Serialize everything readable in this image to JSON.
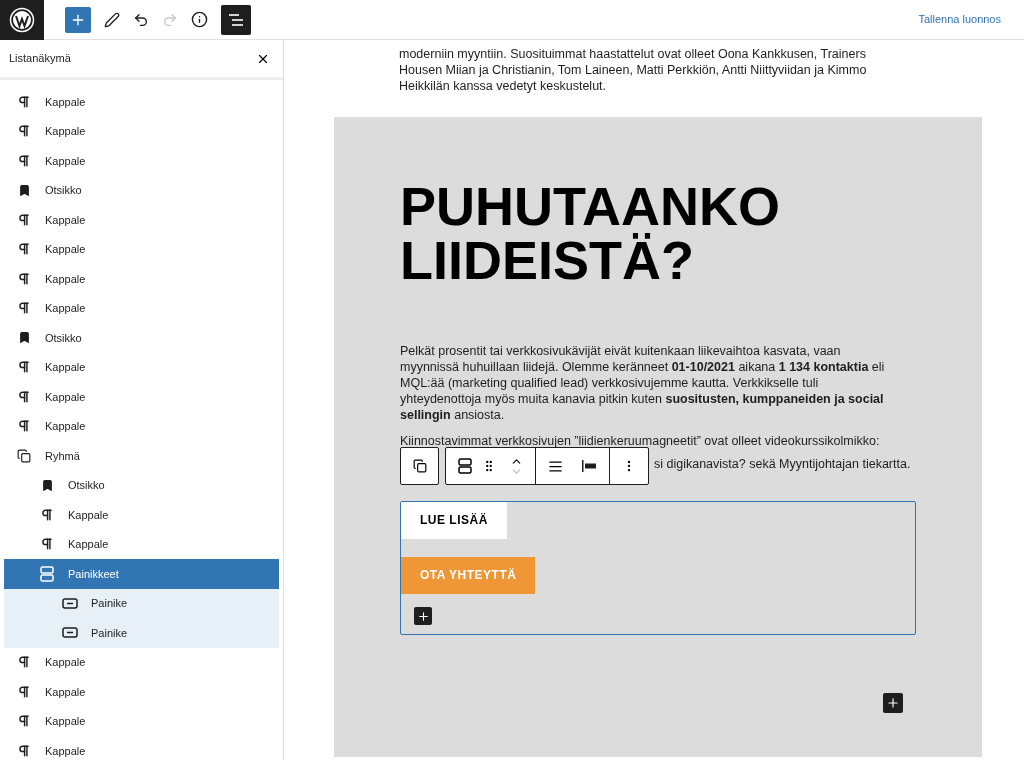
{
  "topbar": {
    "save_label": "Tallenna luonnos",
    "redo_disabled": true,
    "list_view_on": true
  },
  "list_view": {
    "title": "Listanäkymä",
    "items": [
      {
        "kind": "paragraph",
        "label": "Kappale",
        "selected": false
      },
      {
        "kind": "paragraph",
        "label": "Kappale",
        "selected": false
      },
      {
        "kind": "paragraph",
        "label": "Kappale",
        "selected": false
      },
      {
        "kind": "heading",
        "label": "Otsikko",
        "selected": false
      },
      {
        "kind": "paragraph",
        "label": "Kappale",
        "selected": false
      },
      {
        "kind": "paragraph",
        "label": "Kappale",
        "selected": false
      },
      {
        "kind": "paragraph",
        "label": "Kappale",
        "selected": false
      },
      {
        "kind": "paragraph",
        "label": "Kappale",
        "selected": false
      },
      {
        "kind": "heading",
        "label": "Otsikko",
        "selected": false
      },
      {
        "kind": "paragraph",
        "label": "Kappale",
        "selected": false
      },
      {
        "kind": "paragraph",
        "label": "Kappale",
        "selected": false
      },
      {
        "kind": "paragraph",
        "label": "Kappale",
        "selected": false
      },
      {
        "kind": "group",
        "label": "Ryhmä",
        "selected": false,
        "expanded": true,
        "children": [
          {
            "kind": "heading",
            "label": "Otsikko",
            "selected": false
          },
          {
            "kind": "paragraph",
            "label": "Kappale",
            "selected": false
          },
          {
            "kind": "paragraph",
            "label": "Kappale",
            "selected": false
          },
          {
            "kind": "buttons",
            "label": "Painikkeet",
            "selected": true,
            "expanded": true,
            "children": [
              {
                "kind": "button",
                "label": "Painike",
                "selected": false
              },
              {
                "kind": "button",
                "label": "Painike",
                "selected": false
              }
            ]
          }
        ]
      },
      {
        "kind": "paragraph",
        "label": "Kappale",
        "selected": false
      },
      {
        "kind": "paragraph",
        "label": "Kappale",
        "selected": false
      },
      {
        "kind": "paragraph",
        "label": "Kappale",
        "selected": false
      },
      {
        "kind": "paragraph",
        "label": "Kappale",
        "selected": false
      }
    ]
  },
  "content": {
    "intro": "moderniin myyntiin. Suosituimmat haastattelut ovat olleet Oona Kankkusen, Trainers Housen Miian ja Christianin, Tom Laineen, Matti Perkkiön, Antti Niittyviidan ja Kimmo Heikkilän kanssa vedetyt keskustelut.",
    "heading": "PUHUTAANKO LIIDEISTÄ?",
    "paragraph": "Pelkät prosentit tai verkkosivukävijät eivät kuitenkaan liikevaihtoa kasvata, vaan myynnissä huhuillaan liidejä. Olemme keränneet **01-10/2021** aikana **1 134 kontaktia** eli MQL:ää (marketing qualified lead) verkkosivujemme kautta. Verkkikselle tuli yhteydenottoja myös muita kanavia pitkin kuten **suositusten, kumppaneiden ja social sellingin** ansiosta.",
    "paragraph2_line1": "Kiinnostavimmat verkkosivujen ”liidienkeruumagneetit” ovat olleet videokurssikolmikko:",
    "paragraph2_line2": "si digikanavista? sekä Myyntijohtajan tiekartta.",
    "buttons": [
      {
        "kind": "outline",
        "label": "LUE LISÄÄ"
      },
      {
        "kind": "filled",
        "label": "OTA YHTEYTTÄ"
      }
    ]
  }
}
